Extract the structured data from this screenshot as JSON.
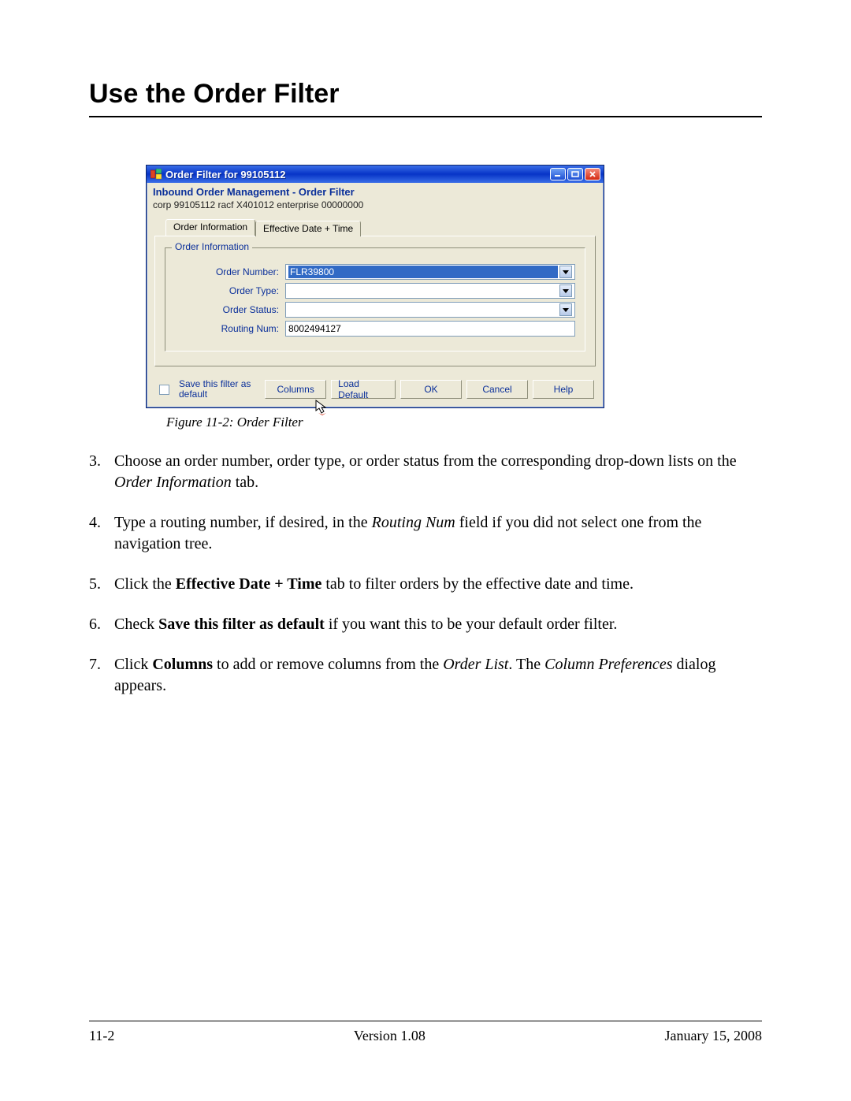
{
  "page": {
    "heading": "Use the Order Filter",
    "figure_caption": "Figure 11-2:   Order Filter",
    "footer": {
      "left": "11-2",
      "center": "Version 1.08",
      "right": "January 15, 2008"
    }
  },
  "dialog": {
    "title": "Order Filter for 99105112",
    "subtitle": "Inbound Order Management - Order Filter",
    "infoline": "corp 99105112  racf X401012   enterprise 00000000",
    "tabs": {
      "order_info": "Order Information",
      "eff_date": "Effective Date + Time"
    },
    "group_legend": "Order Information",
    "fields": {
      "order_number": {
        "label": "Order Number:",
        "value": "FLR39800"
      },
      "order_type": {
        "label": "Order Type:",
        "value": ""
      },
      "order_status": {
        "label": "Order Status:",
        "value": ""
      },
      "routing_num": {
        "label": "Routing Num:",
        "value": "8002494127"
      }
    },
    "checkbox_label": "Save this filter as default",
    "buttons": {
      "columns": "Columns",
      "load_default": "Load Default",
      "ok": "OK",
      "cancel": "Cancel",
      "help": "Help"
    }
  },
  "steps": [
    {
      "num": "3.",
      "parts": [
        {
          "t": "Choose an order number, order type, or order status from the corresponding drop-down lists on the "
        },
        {
          "t": "Order Information",
          "style": "italic"
        },
        {
          "t": " tab."
        }
      ]
    },
    {
      "num": "4.",
      "parts": [
        {
          "t": "Type a routing number, if desired, in the "
        },
        {
          "t": "Routing Num",
          "style": "italic"
        },
        {
          "t": " field if you did not select one from the navigation tree."
        }
      ]
    },
    {
      "num": "5.",
      "parts": [
        {
          "t": "Click the "
        },
        {
          "t": "Effective Date + Time",
          "style": "bold"
        },
        {
          "t": " tab to filter orders by the effective date and time."
        }
      ]
    },
    {
      "num": "6.",
      "parts": [
        {
          "t": "Check "
        },
        {
          "t": "Save this filter as default",
          "style": "bold"
        },
        {
          "t": " if you want this to be your default order filter."
        }
      ]
    },
    {
      "num": "7.",
      "parts": [
        {
          "t": "Click "
        },
        {
          "t": "Columns",
          "style": "bold"
        },
        {
          "t": " to add or remove columns from the "
        },
        {
          "t": "Order List",
          "style": "italic"
        },
        {
          "t": ". The "
        },
        {
          "t": "Column Preferences",
          "style": "italic"
        },
        {
          "t": " dialog appears."
        }
      ]
    }
  ]
}
